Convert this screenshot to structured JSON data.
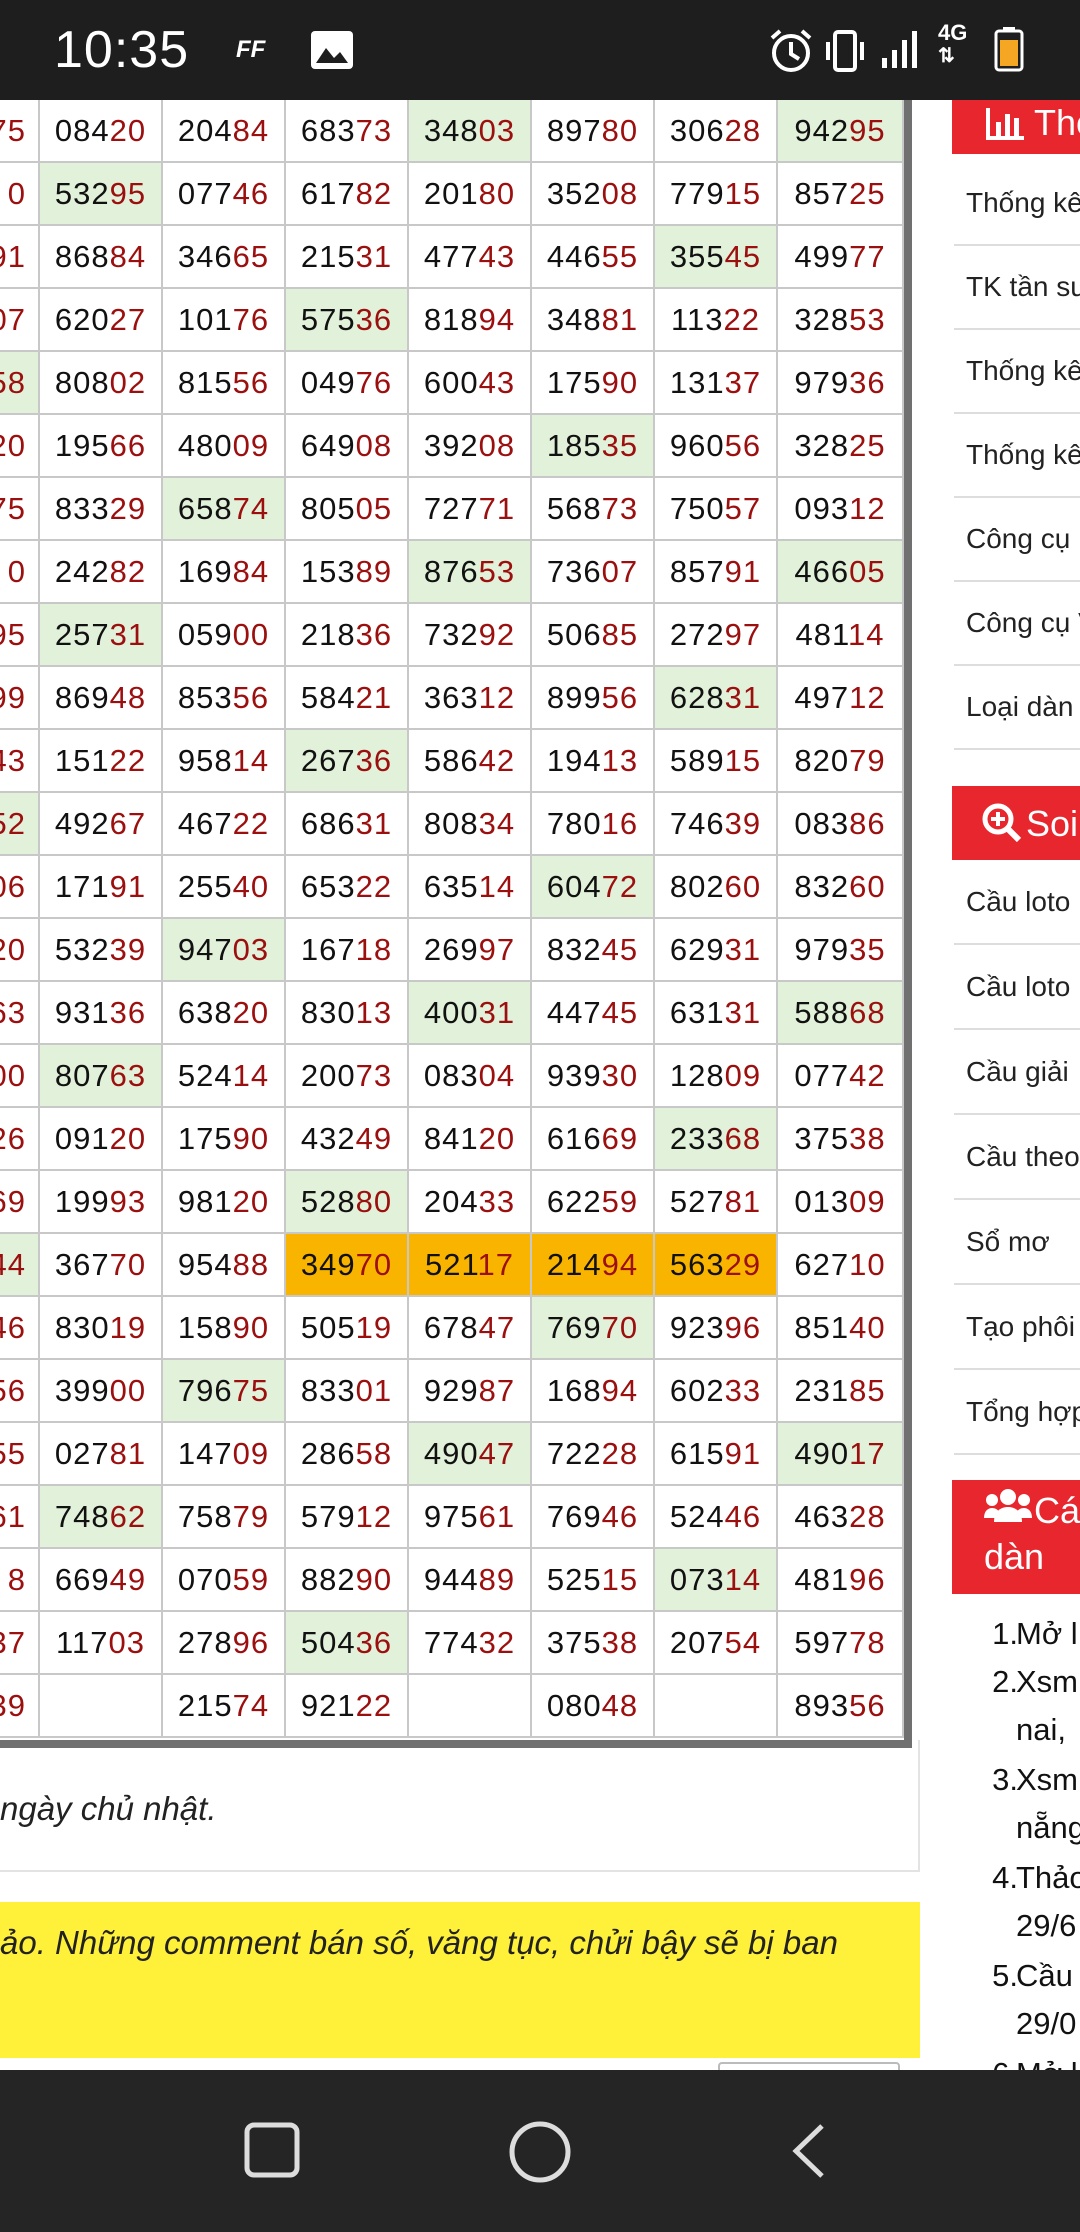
{
  "status_bar": {
    "time": "10:35",
    "app_badge": "FF",
    "network": "4G",
    "icons": [
      "ff-app-icon",
      "gallery-icon",
      "alarm-icon",
      "vibrate-icon",
      "signal-icon",
      "network-4g-icon",
      "battery-icon"
    ]
  },
  "table": {
    "rows": [
      {
        "left": "75",
        "cells": [
          {
            "h": "084",
            "t": "20"
          },
          {
            "h": "204",
            "t": "84"
          },
          {
            "h": "683",
            "t": "73"
          },
          {
            "h": "348",
            "t": "03",
            "hl": true
          },
          {
            "h": "897",
            "t": "80"
          },
          {
            "h": "306",
            "t": "28"
          },
          {
            "h": "942",
            "t": "95",
            "hl": true
          }
        ]
      },
      {
        "left": "0",
        "cells": [
          {
            "h": "532",
            "t": "95",
            "hl": true
          },
          {
            "h": "077",
            "t": "46"
          },
          {
            "h": "617",
            "t": "82"
          },
          {
            "h": "201",
            "t": "80"
          },
          {
            "h": "352",
            "t": "08"
          },
          {
            "h": "779",
            "t": "15"
          },
          {
            "h": "857",
            "t": "25"
          }
        ]
      },
      {
        "left": "91",
        "cells": [
          {
            "h": "868",
            "t": "84"
          },
          {
            "h": "346",
            "t": "65"
          },
          {
            "h": "215",
            "t": "31"
          },
          {
            "h": "477",
            "t": "43"
          },
          {
            "h": "446",
            "t": "55"
          },
          {
            "h": "355",
            "t": "45",
            "hl": true
          },
          {
            "h": "499",
            "t": "77"
          }
        ]
      },
      {
        "left": "07",
        "cells": [
          {
            "h": "620",
            "t": "27"
          },
          {
            "h": "101",
            "t": "76"
          },
          {
            "h": "575",
            "t": "36",
            "hl": true
          },
          {
            "h": "818",
            "t": "94"
          },
          {
            "h": "348",
            "t": "81"
          },
          {
            "h": "113",
            "t": "22"
          },
          {
            "h": "328",
            "t": "53"
          }
        ]
      },
      {
        "left": "58",
        "lhl": true,
        "cells": [
          {
            "h": "808",
            "t": "02"
          },
          {
            "h": "815",
            "t": "56"
          },
          {
            "h": "049",
            "t": "76"
          },
          {
            "h": "600",
            "t": "43"
          },
          {
            "h": "175",
            "t": "90"
          },
          {
            "h": "131",
            "t": "37"
          },
          {
            "h": "979",
            "t": "36"
          }
        ]
      },
      {
        "left": "20",
        "cells": [
          {
            "h": "195",
            "t": "66"
          },
          {
            "h": "480",
            "t": "09"
          },
          {
            "h": "649",
            "t": "08"
          },
          {
            "h": "392",
            "t": "08"
          },
          {
            "h": "185",
            "t": "35",
            "hl": true
          },
          {
            "h": "960",
            "t": "56"
          },
          {
            "h": "328",
            "t": "25"
          }
        ]
      },
      {
        "left": "75",
        "cells": [
          {
            "h": "833",
            "t": "29"
          },
          {
            "h": "658",
            "t": "74",
            "hl": true
          },
          {
            "h": "805",
            "t": "05"
          },
          {
            "h": "727",
            "t": "71"
          },
          {
            "h": "568",
            "t": "73"
          },
          {
            "h": "750",
            "t": "57"
          },
          {
            "h": "093",
            "t": "12"
          }
        ]
      },
      {
        "left": "0",
        "cells": [
          {
            "h": "242",
            "t": "82"
          },
          {
            "h": "169",
            "t": "84"
          },
          {
            "h": "153",
            "t": "89"
          },
          {
            "h": "876",
            "t": "53",
            "hl": true
          },
          {
            "h": "736",
            "t": "07"
          },
          {
            "h": "857",
            "t": "91"
          },
          {
            "h": "466",
            "t": "05",
            "hl": true
          }
        ]
      },
      {
        "left": "95",
        "cells": [
          {
            "h": "257",
            "t": "31",
            "hl": true
          },
          {
            "h": "059",
            "t": "00"
          },
          {
            "h": "218",
            "t": "36"
          },
          {
            "h": "732",
            "t": "92"
          },
          {
            "h": "506",
            "t": "85"
          },
          {
            "h": "272",
            "t": "97"
          },
          {
            "h": "481",
            "t": "14"
          }
        ]
      },
      {
        "left": "99",
        "cells": [
          {
            "h": "869",
            "t": "48"
          },
          {
            "h": "853",
            "t": "56"
          },
          {
            "h": "584",
            "t": "21"
          },
          {
            "h": "363",
            "t": "12"
          },
          {
            "h": "899",
            "t": "56"
          },
          {
            "h": "628",
            "t": "31",
            "hl": true
          },
          {
            "h": "497",
            "t": "12"
          }
        ]
      },
      {
        "left": "43",
        "cells": [
          {
            "h": "151",
            "t": "22"
          },
          {
            "h": "958",
            "t": "14"
          },
          {
            "h": "267",
            "t": "36",
            "hl": true
          },
          {
            "h": "586",
            "t": "42"
          },
          {
            "h": "194",
            "t": "13"
          },
          {
            "h": "589",
            "t": "15"
          },
          {
            "h": "820",
            "t": "79"
          }
        ]
      },
      {
        "left": "52",
        "lhl": true,
        "cells": [
          {
            "h": "492",
            "t": "67"
          },
          {
            "h": "467",
            "t": "22"
          },
          {
            "h": "686",
            "t": "31"
          },
          {
            "h": "808",
            "t": "34"
          },
          {
            "h": "780",
            "t": "16"
          },
          {
            "h": "746",
            "t": "39"
          },
          {
            "h": "083",
            "t": "86"
          }
        ]
      },
      {
        "left": "06",
        "cells": [
          {
            "h": "171",
            "t": "91"
          },
          {
            "h": "255",
            "t": "40"
          },
          {
            "h": "653",
            "t": "22"
          },
          {
            "h": "635",
            "t": "14"
          },
          {
            "h": "604",
            "t": "72",
            "hl": true
          },
          {
            "h": "802",
            "t": "60"
          },
          {
            "h": "832",
            "t": "60"
          }
        ]
      },
      {
        "left": "20",
        "cells": [
          {
            "h": "532",
            "t": "39"
          },
          {
            "h": "947",
            "t": "03",
            "hl": true
          },
          {
            "h": "167",
            "t": "18"
          },
          {
            "h": "269",
            "t": "97"
          },
          {
            "h": "832",
            "t": "45"
          },
          {
            "h": "629",
            "t": "31"
          },
          {
            "h": "979",
            "t": "35"
          }
        ]
      },
      {
        "left": "63",
        "cells": [
          {
            "h": "931",
            "t": "36"
          },
          {
            "h": "638",
            "t": "20"
          },
          {
            "h": "830",
            "t": "13"
          },
          {
            "h": "400",
            "t": "31",
            "hl": true
          },
          {
            "h": "447",
            "t": "45"
          },
          {
            "h": "631",
            "t": "31"
          },
          {
            "h": "588",
            "t": "68",
            "hl": true
          }
        ]
      },
      {
        "left": "00",
        "cells": [
          {
            "h": "807",
            "t": "63",
            "hl": true
          },
          {
            "h": "524",
            "t": "14"
          },
          {
            "h": "200",
            "t": "73"
          },
          {
            "h": "083",
            "t": "04"
          },
          {
            "h": "939",
            "t": "30"
          },
          {
            "h": "128",
            "t": "09"
          },
          {
            "h": "077",
            "t": "42"
          }
        ]
      },
      {
        "left": "26",
        "cells": [
          {
            "h": "091",
            "t": "20"
          },
          {
            "h": "175",
            "t": "90"
          },
          {
            "h": "432",
            "t": "49"
          },
          {
            "h": "841",
            "t": "20"
          },
          {
            "h": "616",
            "t": "69"
          },
          {
            "h": "233",
            "t": "68",
            "hl": true
          },
          {
            "h": "375",
            "t": "38"
          }
        ]
      },
      {
        "left": "69",
        "cells": [
          {
            "h": "199",
            "t": "93"
          },
          {
            "h": "981",
            "t": "20"
          },
          {
            "h": "528",
            "t": "80",
            "hl": true
          },
          {
            "h": "204",
            "t": "33"
          },
          {
            "h": "622",
            "t": "59"
          },
          {
            "h": "527",
            "t": "81"
          },
          {
            "h": "013",
            "t": "09"
          }
        ]
      },
      {
        "left": "44",
        "lhl": true,
        "cells": [
          {
            "h": "367",
            "t": "70"
          },
          {
            "h": "954",
            "t": "88"
          },
          {
            "h": "349",
            "t": "70",
            "ol": true
          },
          {
            "h": "521",
            "t": "17",
            "ol": true
          },
          {
            "h": "214",
            "t": "94",
            "ol": true
          },
          {
            "h": "563",
            "t": "29",
            "ol": true
          },
          {
            "h": "627",
            "t": "10"
          }
        ]
      },
      {
        "left": "46",
        "cells": [
          {
            "h": "830",
            "t": "19"
          },
          {
            "h": "158",
            "t": "90"
          },
          {
            "h": "505",
            "t": "19"
          },
          {
            "h": "678",
            "t": "47"
          },
          {
            "h": "769",
            "t": "70",
            "hl": true
          },
          {
            "h": "923",
            "t": "96"
          },
          {
            "h": "851",
            "t": "40"
          }
        ]
      },
      {
        "left": "56",
        "cells": [
          {
            "h": "399",
            "t": "00"
          },
          {
            "h": "796",
            "t": "75",
            "hl": true
          },
          {
            "h": "833",
            "t": "01"
          },
          {
            "h": "929",
            "t": "87"
          },
          {
            "h": "168",
            "t": "94"
          },
          {
            "h": "602",
            "t": "33"
          },
          {
            "h": "231",
            "t": "85"
          }
        ]
      },
      {
        "left": "55",
        "cells": [
          {
            "h": "027",
            "t": "81"
          },
          {
            "h": "147",
            "t": "09"
          },
          {
            "h": "286",
            "t": "58"
          },
          {
            "h": "490",
            "t": "47",
            "hl": true
          },
          {
            "h": "722",
            "t": "28"
          },
          {
            "h": "615",
            "t": "91"
          },
          {
            "h": "490",
            "t": "17",
            "hl": true
          }
        ]
      },
      {
        "left": "61",
        "cells": [
          {
            "h": "748",
            "t": "62",
            "hl": true
          },
          {
            "h": "758",
            "t": "79"
          },
          {
            "h": "579",
            "t": "12"
          },
          {
            "h": "975",
            "t": "61"
          },
          {
            "h": "769",
            "t": "46"
          },
          {
            "h": "524",
            "t": "46"
          },
          {
            "h": "463",
            "t": "28"
          }
        ]
      },
      {
        "left": "8",
        "cells": [
          {
            "h": "669",
            "t": "49"
          },
          {
            "h": "070",
            "t": "59"
          },
          {
            "h": "882",
            "t": "90"
          },
          {
            "h": "944",
            "t": "89"
          },
          {
            "h": "525",
            "t": "15"
          },
          {
            "h": "073",
            "t": "14",
            "hl": true
          },
          {
            "h": "481",
            "t": "96"
          }
        ]
      },
      {
        "left": "37",
        "cells": [
          {
            "h": "117",
            "t": "03"
          },
          {
            "h": "278",
            "t": "96"
          },
          {
            "h": "504",
            "t": "36",
            "hl": true
          },
          {
            "h": "774",
            "t": "32"
          },
          {
            "h": "375",
            "t": "38"
          },
          {
            "h": "207",
            "t": "54"
          },
          {
            "h": "597",
            "t": "78"
          }
        ]
      },
      {
        "left": "39",
        "cells": [
          {
            "h": "",
            "t": ""
          },
          {
            "h": "215",
            "t": "74"
          },
          {
            "h": "921",
            "t": "22"
          },
          {
            "h": "",
            "t": ""
          },
          {
            "h": "080",
            "t": "48"
          },
          {
            "h": "",
            "t": ""
          },
          {
            "h": "893",
            "t": "56"
          }
        ]
      }
    ]
  },
  "note": "ngày chủ nhật.",
  "warning": "ảo. Những comment bán số, văng tục, chửi bậy sẽ bị ban",
  "sidebar": {
    "stats_header": "Thố",
    "stats_items": [
      "Thống kê",
      "TK tần su",
      "Thống kê",
      "Thống kê",
      "Công cụ",
      "Công cụ VIP",
      "Loại dàn"
    ],
    "soi_header": "Soi",
    "soi_items": [
      "Cầu loto",
      "Cầu loto",
      "Cầu giải",
      "Cầu theo",
      "Sổ mơ",
      "Tạo phôi",
      "Tổng hợp"
    ],
    "dan_header_1": "Cá",
    "dan_header_2": "dàn",
    "ordered_list": [
      {
        "n": "1.",
        "lines": [
          "Mở l"
        ]
      },
      {
        "n": "2.",
        "lines": [
          "Xsm",
          "nai,"
        ]
      },
      {
        "n": "3.",
        "lines": [
          "Xsm",
          "nẵng"
        ]
      },
      {
        "n": "4.",
        "lines": [
          "Thảo",
          "29/6"
        ]
      },
      {
        "n": "5.",
        "lines": [
          "Cầu",
          "29/0"
        ]
      },
      {
        "n": "6.",
        "lines": [
          "Mở l"
        ]
      }
    ]
  },
  "colors": {
    "highlight": "#e2f1d9",
    "orange": "#f9b400",
    "tail": "#9b0f0f",
    "red": "#e8262d",
    "warning": "#fff03a"
  }
}
